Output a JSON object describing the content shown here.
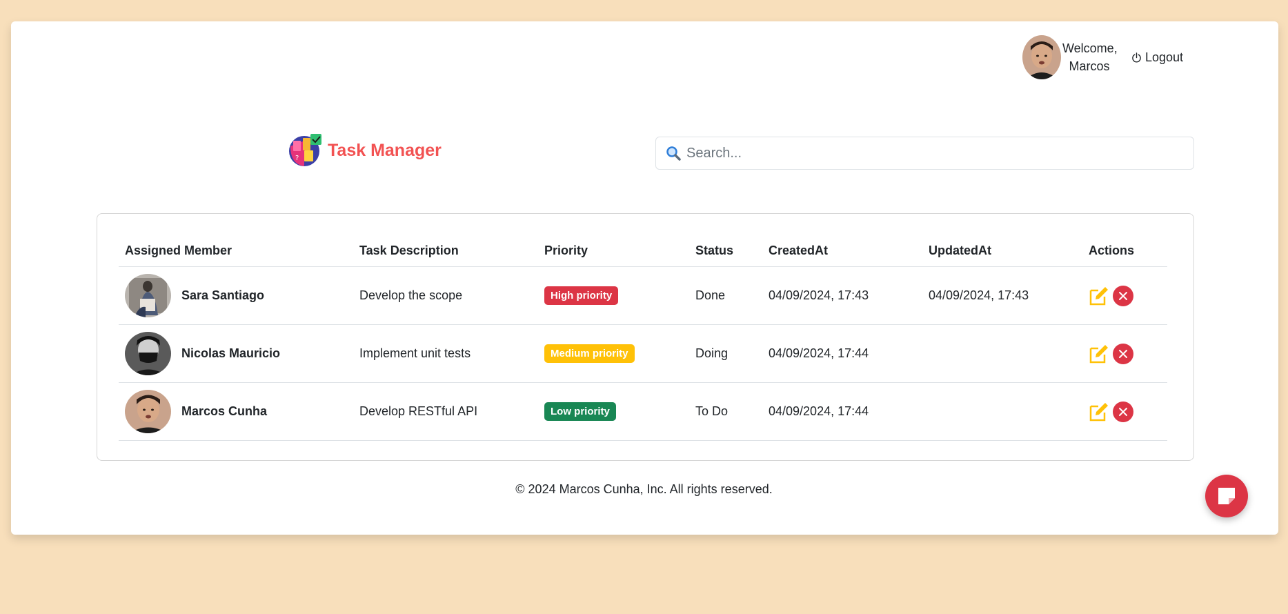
{
  "header": {
    "welcome_line1": "Welcome,",
    "welcome_line2": "Marcos",
    "logout_label": "Logout"
  },
  "brand": {
    "name": "Task Manager"
  },
  "search": {
    "placeholder": "Search..."
  },
  "table": {
    "columns": [
      "Assigned Member",
      "Task Description",
      "Priority",
      "Status",
      "CreatedAt",
      "UpdatedAt",
      "Actions"
    ],
    "rows": [
      {
        "member": "Sara Santiago",
        "description": "Develop the scope",
        "priority": "High priority",
        "status": "Done",
        "created": "04/09/2024, 17:43",
        "updated": "04/09/2024, 17:43"
      },
      {
        "member": "Nicolas Mauricio",
        "description": "Implement unit tests",
        "priority": "Medium priority",
        "status": "Doing",
        "created": "04/09/2024, 17:44",
        "updated": ""
      },
      {
        "member": "Marcos Cunha",
        "description": "Develop RESTful API",
        "priority": "Low priority",
        "status": "To Do",
        "created": "04/09/2024, 17:44",
        "updated": ""
      }
    ]
  },
  "footer": {
    "copyright": "© 2024 Marcos Cunha, Inc. All rights reserved."
  },
  "colors": {
    "background": "#f8dfbb",
    "brand": "#f25252",
    "high": "#dc3545",
    "medium": "#ffc107",
    "low": "#198754",
    "edit": "#ffc107",
    "delete": "#dc3545"
  },
  "icons": {
    "logout": "power-icon",
    "search": "magnifier-icon",
    "edit": "pencil-square-icon",
    "delete": "x-circle-icon",
    "fab": "sticky-note-icon"
  }
}
